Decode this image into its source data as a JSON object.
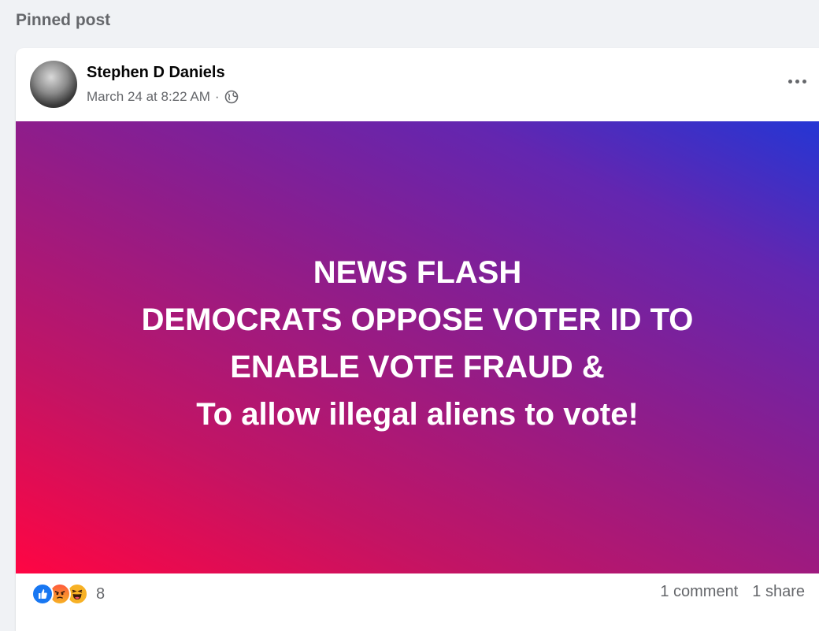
{
  "section": {
    "label": "Pinned post"
  },
  "post": {
    "author": "Stephen D Daniels",
    "date": "March 24 at 8:22 AM",
    "separator": "·",
    "privacy_icon": "globe-icon",
    "more_icon": "more-horiz-icon",
    "lines": [
      "NEWS FLASH",
      "DEMOCRATS OPPOSE VOTER ID TO",
      "ENABLE VOTE FRAUD &",
      "To allow illegal aliens to vote!"
    ],
    "gradient_colors": [
      "#ff0543",
      "#8d1d8c",
      "#2436d4"
    ]
  },
  "footer": {
    "reaction_icons": [
      "like-reaction-icon",
      "angry-reaction-icon",
      "haha-reaction-icon"
    ],
    "reaction_count": "8",
    "comments": "1 comment",
    "shares": "1 share"
  }
}
